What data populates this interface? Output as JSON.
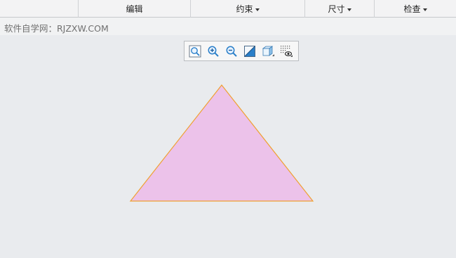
{
  "ribbon": {
    "groups": [
      {
        "label": "编辑",
        "has_dropdown": false
      },
      {
        "label": "约束",
        "has_dropdown": true
      },
      {
        "label": "尺寸",
        "has_dropdown": true
      },
      {
        "label": "检查",
        "has_dropdown": true
      }
    ]
  },
  "watermark": {
    "text": "软件自学网：RJZXW.COM"
  },
  "view_toolbar": {
    "tools": [
      "zoom-fit-icon",
      "zoom-in-icon",
      "zoom-out-icon",
      "repaint-icon",
      "view-orientation-icon",
      "display-filter-icon"
    ]
  },
  "sketch": {
    "shape": "triangle",
    "fill_color": "#ecc2ea",
    "stroke_color": "#f0a030"
  },
  "colors": {
    "background": "#e9ebee",
    "ribbon": "#f3f3f4",
    "icon_blue": "#2a7fc9"
  }
}
